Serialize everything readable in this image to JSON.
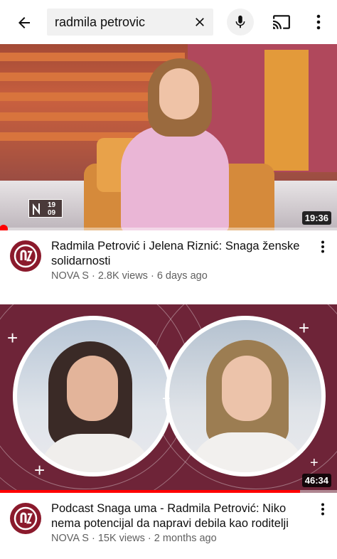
{
  "search": {
    "query": "radmila petrovic"
  },
  "icons": {
    "back": "arrow-back-icon",
    "clear": "close-icon",
    "mic": "microphone-icon",
    "cast": "cast-icon",
    "more": "more-vert-icon"
  },
  "videos": [
    {
      "title": "Radmila Petrović i Jelena Riznić: Snaga ženske solidarnosti",
      "channel": "NOVA S",
      "views": "2.8K views",
      "age": "6 days ago",
      "duration": "19:36",
      "watched_fraction": 0.01,
      "logo_text_top": "19",
      "logo_text_bottom": "09"
    },
    {
      "title": "Podcast Snaga uma - Radmila Petrović: Niko nema potencijal da napravi debila kao roditelji",
      "channel": "NOVA S",
      "views": "15K views",
      "age": "2 months ago",
      "duration": "46:34",
      "watched_fraction": 0.89
    }
  ],
  "colors": {
    "progress": "#ff0000",
    "channel_avatar": "#8b1a2c",
    "thumb2_bg": "#6e2438"
  },
  "separator": " · "
}
